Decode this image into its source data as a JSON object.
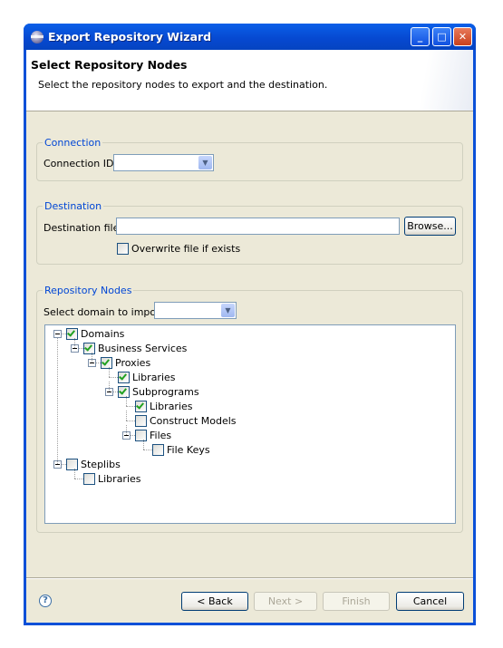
{
  "window": {
    "title": "Export Repository Wizard",
    "icon": "eclipse-icon"
  },
  "header": {
    "title": "Select Repository Nodes",
    "description": "Select the repository nodes to export and the destination."
  },
  "connection": {
    "group_label": "Connection",
    "id_label": "Connection ID:",
    "id_value": ""
  },
  "destination": {
    "group_label": "Destination",
    "file_label": "Destination file:",
    "file_value": "",
    "browse_label": "Browse...",
    "overwrite_label": "Overwrite file if exists",
    "overwrite_checked": false
  },
  "repository": {
    "group_label": "Repository Nodes",
    "domain_label": "Select domain to import:",
    "domain_value": "",
    "tree": [
      {
        "label": "Domains",
        "level": 0,
        "expanded": true,
        "checked": true
      },
      {
        "label": "Business Services",
        "level": 1,
        "expanded": true,
        "checked": true
      },
      {
        "label": "Proxies",
        "level": 2,
        "expanded": true,
        "checked": true
      },
      {
        "label": "Libraries",
        "level": 3,
        "checked": true
      },
      {
        "label": "Subprograms",
        "level": 3,
        "expanded": true,
        "checked": true
      },
      {
        "label": "Libraries",
        "level": 4,
        "checked": true
      },
      {
        "label": "Construct Models",
        "level": 4,
        "checked": false
      },
      {
        "label": "Files",
        "level": 4,
        "expanded": true,
        "checked": false
      },
      {
        "label": "File Keys",
        "level": 5,
        "checked": false
      },
      {
        "label": "Steplibs",
        "level": 0,
        "expanded": true,
        "checked": false
      },
      {
        "label": "Libraries",
        "level": 1,
        "checked": false
      }
    ]
  },
  "buttons": {
    "back": "< Back",
    "next": "Next >",
    "finish": "Finish",
    "cancel": "Cancel",
    "next_enabled": false,
    "finish_enabled": false
  }
}
